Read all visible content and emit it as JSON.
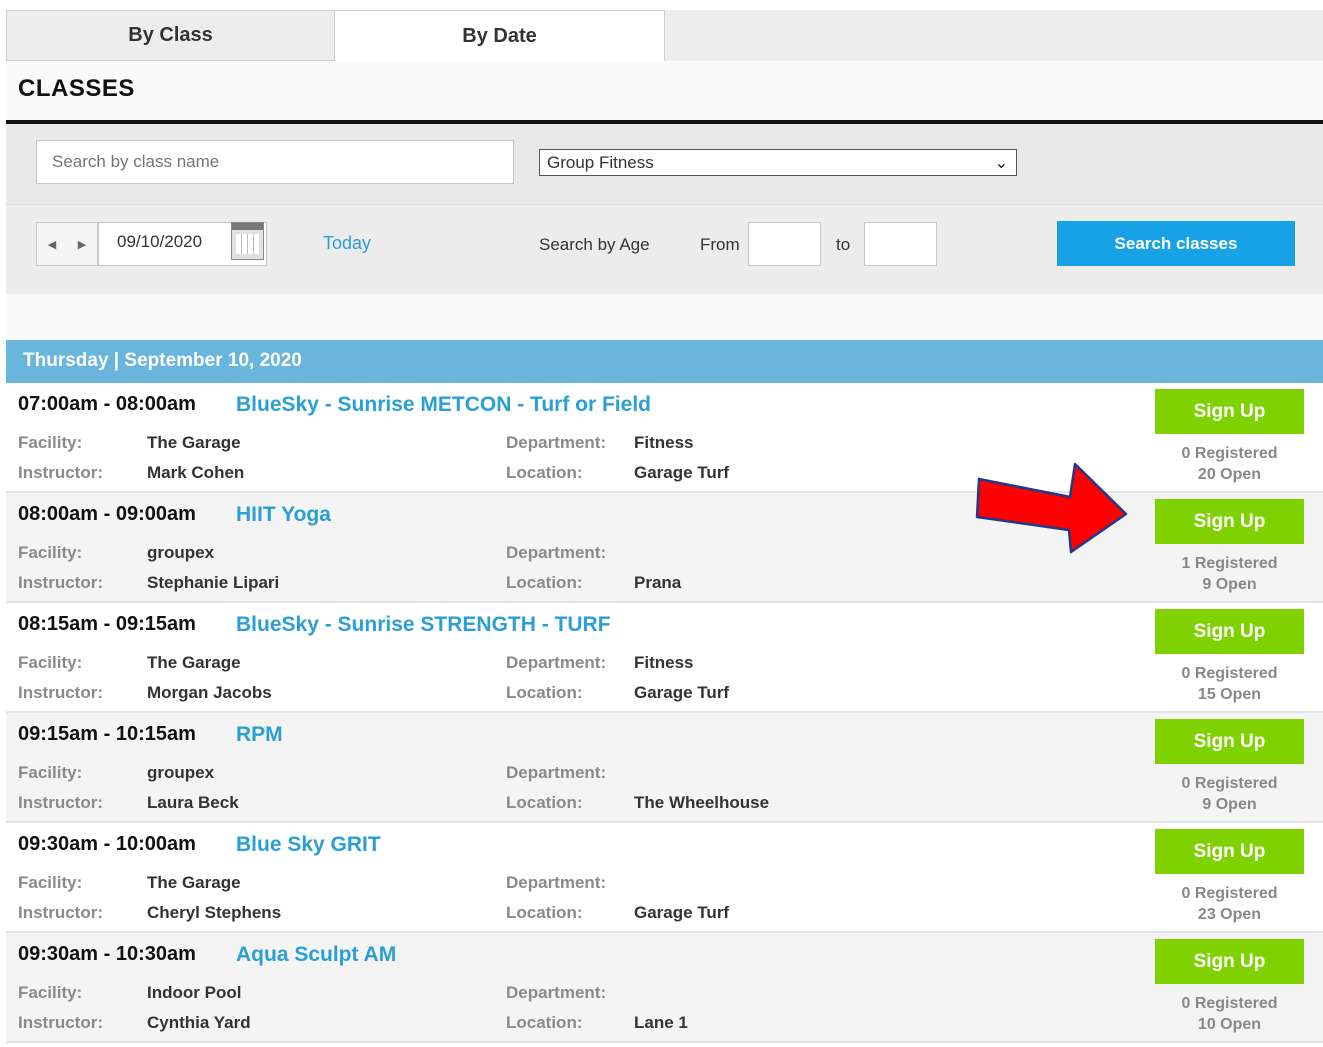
{
  "tabs": {
    "by_class": "By Class",
    "by_date": "By Date"
  },
  "page_title": "CLASSES",
  "filters": {
    "search_placeholder": "Search by class name",
    "category_selected": "Group Fitness",
    "date_value": "09/10/2020",
    "today_label": "Today",
    "age_label": "Search by Age",
    "from_label": "From",
    "to_label": "to",
    "search_button": "Search classes"
  },
  "day_header": "Thursday | September 10, 2020",
  "labels": {
    "facility": "Facility:",
    "instructor": "Instructor:",
    "department": "Department:",
    "location": "Location:"
  },
  "classes": [
    {
      "time": "07:00am - 08:00am",
      "name": "BlueSky - Sunrise METCON - Turf or Field",
      "facility": "The Garage",
      "instructor": "Mark Cohen",
      "department": "Fitness",
      "location": "Garage Turf",
      "button": "Sign Up",
      "registered": "0 Registered",
      "open": "20 Open"
    },
    {
      "time": "08:00am - 09:00am",
      "name": "HIIT Yoga",
      "facility": "groupex",
      "instructor": "Stephanie Lipari",
      "department": "",
      "location": "Prana",
      "button": "Sign Up",
      "registered": "1 Registered",
      "open": "9 Open"
    },
    {
      "time": "08:15am - 09:15am",
      "name": "BlueSky - Sunrise STRENGTH - TURF",
      "facility": "The Garage",
      "instructor": "Morgan Jacobs",
      "department": "Fitness",
      "location": "Garage Turf",
      "button": "Sign Up",
      "registered": "0 Registered",
      "open": "15 Open"
    },
    {
      "time": "09:15am - 10:15am",
      "name": "RPM",
      "facility": "groupex",
      "instructor": "Laura Beck",
      "department": "",
      "location": "The Wheelhouse",
      "button": "Sign Up",
      "registered": "0 Registered",
      "open": "9 Open"
    },
    {
      "time": "09:30am - 10:00am",
      "name": "Blue Sky GRIT",
      "facility": "The Garage",
      "instructor": "Cheryl Stephens",
      "department": "",
      "location": "Garage Turf",
      "button": "Sign Up",
      "registered": "0 Registered",
      "open": "23 Open"
    },
    {
      "time": "09:30am - 10:30am",
      "name": "Aqua Sculpt AM",
      "facility": "Indoor Pool",
      "instructor": "Cynthia Yard",
      "department": "",
      "location": "Lane 1",
      "button": "Sign Up",
      "registered": "0 Registered",
      "open": "10 Open"
    }
  ],
  "colors": {
    "accent_blue": "#2a9fd6",
    "search_button": "#17a1e6",
    "signup_green": "#7fd100",
    "day_header": "#69b5db",
    "annotation_arrow": "#ff0000"
  },
  "icons": {
    "calendar": "calendar-icon",
    "prev": "chevron-left-icon",
    "next": "chevron-right-icon",
    "dropdown": "chevron-down-icon"
  }
}
